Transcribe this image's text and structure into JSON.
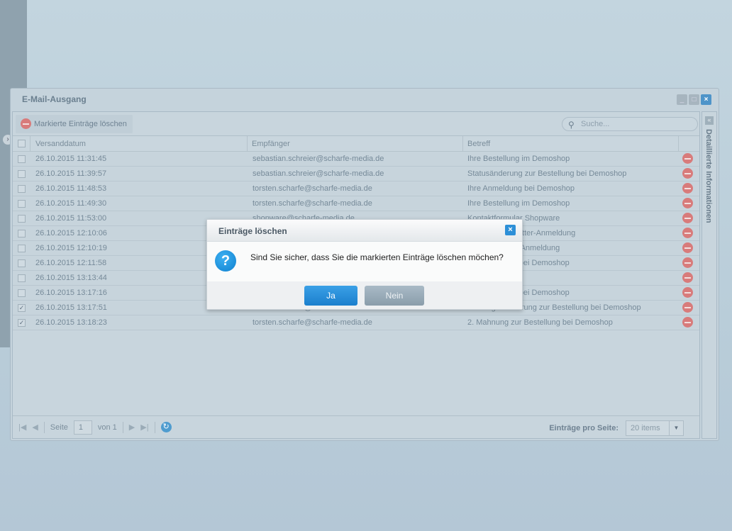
{
  "window": {
    "title": "E-Mail-Ausgang"
  },
  "toolbar": {
    "delete_marked_label": "Markierte Einträge löschen",
    "search_placeholder": "Suche..."
  },
  "grid": {
    "columns": [
      "Versanddatum",
      "Empfänger",
      "Betreff"
    ],
    "rows": [
      {
        "checked": false,
        "date": "26.10.2015 11:31:45",
        "recipient": "sebastian.schreier@scharfe-media.de",
        "subject": "Ihre Bestellung im Demoshop"
      },
      {
        "checked": false,
        "date": "26.10.2015 11:39:57",
        "recipient": "sebastian.schreier@scharfe-media.de",
        "subject": "Statusänderung zur Bestellung bei Demoshop"
      },
      {
        "checked": false,
        "date": "26.10.2015 11:48:53",
        "recipient": "torsten.scharfe@scharfe-media.de",
        "subject": "Ihre Anmeldung bei Demoshop"
      },
      {
        "checked": false,
        "date": "26.10.2015 11:49:30",
        "recipient": "torsten.scharfe@scharfe-media.de",
        "subject": "Ihre Bestellung im Demoshop"
      },
      {
        "checked": false,
        "date": "26.10.2015 11:53:00",
        "recipient": "shopware@scharfe-media.de",
        "subject": "Kontaktformular Shopware"
      },
      {
        "checked": false,
        "date": "26.10.2015 12:10:06",
        "recipient": "",
        "subject": "Sie Ihre Newsletter-Anmeldung"
      },
      {
        "checked": false,
        "date": "26.10.2015 12:10:19",
        "recipient": "",
        "subject": "hre Newsletter-Anmeldung"
      },
      {
        "checked": false,
        "date": "26.10.2015 12:11:58",
        "recipient": "",
        "subject": "zur Bestellung bei Demoshop"
      },
      {
        "checked": false,
        "date": "26.10.2015 13:13:44",
        "recipient": "",
        "subject": "n Demoshop"
      },
      {
        "checked": false,
        "date": "26.10.2015 13:17:16",
        "recipient": "",
        "subject": "zur Bestellung bei Demoshop"
      },
      {
        "checked": true,
        "date": "26.10.2015 13:17:51",
        "recipient": "torsten.scharfe@scharfe-media.de",
        "subject": "Zahlungserinnerung zur Bestellung bei Demoshop"
      },
      {
        "checked": true,
        "date": "26.10.2015 13:18:23",
        "recipient": "torsten.scharfe@scharfe-media.de",
        "subject": "2. Mahnung zur Bestellung bei Demoshop"
      }
    ]
  },
  "pager": {
    "page_label": "Seite",
    "page": "1",
    "of_label": "von 1",
    "per_page_label": "Einträge pro Seite:",
    "per_page_value": "20 items"
  },
  "sidebar": {
    "label": "Detaillierte Informationen"
  },
  "dialog": {
    "title": "Einträge löschen",
    "message": "Sind Sie sicher, dass Sie die markierten Einträge löschen möchen?",
    "yes_label": "Ja",
    "no_label": "Nein"
  },
  "colors": {
    "accent": "#2d8fd7",
    "delete": "#d87b7b"
  }
}
